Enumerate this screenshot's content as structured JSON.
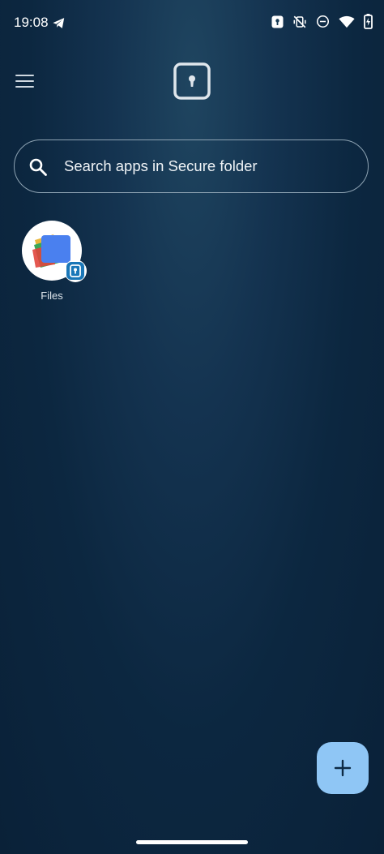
{
  "status_bar": {
    "time": "19:08",
    "icons": [
      "telegram-icon",
      "secure-folder-status-icon",
      "vibrate-off-icon",
      "do-not-disturb-icon",
      "wifi-icon",
      "battery-charging-icon"
    ]
  },
  "header": {
    "menu_icon": "hamburger-menu-icon",
    "logo_icon": "secure-folder-icon"
  },
  "search": {
    "placeholder": "Search apps in Secure folder"
  },
  "apps": [
    {
      "label": "Files",
      "icon": "files-app-icon",
      "badge": "secure-folder-badge-icon"
    }
  ],
  "fab": {
    "icon": "plus-icon"
  },
  "colors": {
    "background_top": "#1f4560",
    "background_bottom": "#0a2138",
    "fab": "#8fc6f5",
    "badge": "#1a77b8"
  }
}
